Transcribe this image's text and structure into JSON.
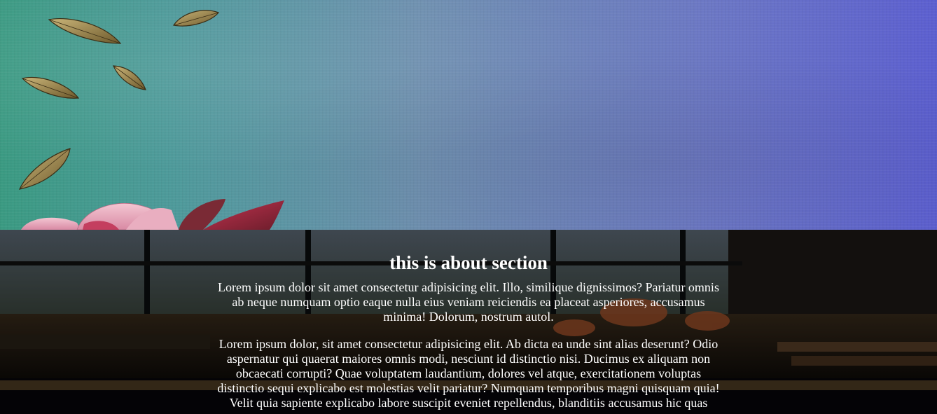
{
  "hero": {
    "image": "watercolor-teal-purple-background-with-leaves-and-flower"
  },
  "about": {
    "background_image": "cafe-interior-with-chairs-and-windows",
    "title": "this is about section",
    "paragraphs": [
      "Lorem ipsum dolor sit amet consectetur adipisicing elit. Illo, similique dignissimos? Pariatur omnis ab neque numquam optio eaque nulla eius veniam reiciendis ea placeat asperiores, accusamus minima! Dolorum, nostrum autol.",
      "Lorem ipsum dolor, sit amet consectetur adipisicing elit. Ab dicta ea unde sint alias deserunt? Odio aspernatur qui quaerat maiores omnis modi, nesciunt id distinctio nisi. Ducimus ex aliquam non obcaecati corrupti? Quae voluptatem laudantium, dolores vel atque, exercitationem voluptas distinctio sequi explicabo est molestias velit pariatur? Numquam temporibus magni quisquam quia! Velit quia sapiente explicabo labore suscipit eveniet repellendus, blanditiis accusamus hic quas"
    ]
  }
}
